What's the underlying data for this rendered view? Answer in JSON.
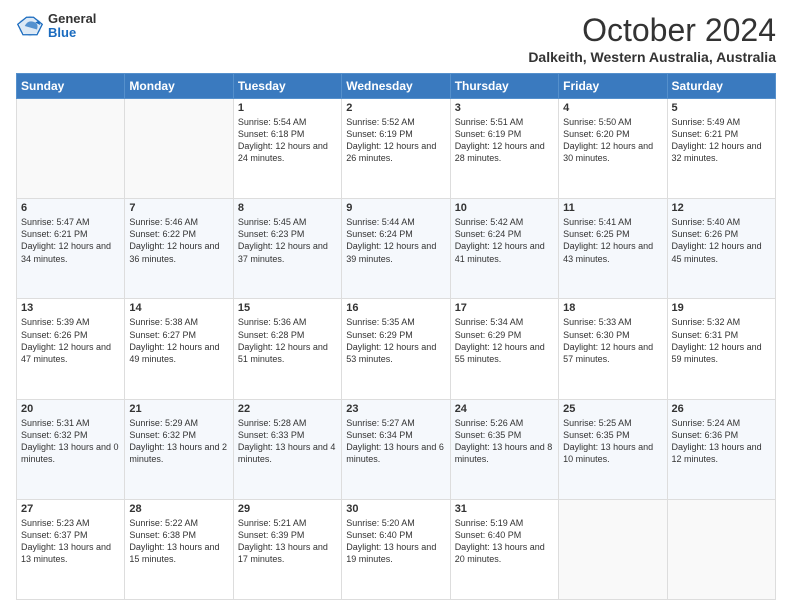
{
  "header": {
    "logo_general": "General",
    "logo_blue": "Blue",
    "month_title": "October 2024",
    "location": "Dalkeith, Western Australia, Australia"
  },
  "days_of_week": [
    "Sunday",
    "Monday",
    "Tuesday",
    "Wednesday",
    "Thursday",
    "Friday",
    "Saturday"
  ],
  "weeks": [
    [
      {
        "num": "",
        "info": ""
      },
      {
        "num": "",
        "info": ""
      },
      {
        "num": "1",
        "info": "Sunrise: 5:54 AM\nSunset: 6:18 PM\nDaylight: 12 hours and 24 minutes."
      },
      {
        "num": "2",
        "info": "Sunrise: 5:52 AM\nSunset: 6:19 PM\nDaylight: 12 hours and 26 minutes."
      },
      {
        "num": "3",
        "info": "Sunrise: 5:51 AM\nSunset: 6:19 PM\nDaylight: 12 hours and 28 minutes."
      },
      {
        "num": "4",
        "info": "Sunrise: 5:50 AM\nSunset: 6:20 PM\nDaylight: 12 hours and 30 minutes."
      },
      {
        "num": "5",
        "info": "Sunrise: 5:49 AM\nSunset: 6:21 PM\nDaylight: 12 hours and 32 minutes."
      }
    ],
    [
      {
        "num": "6",
        "info": "Sunrise: 5:47 AM\nSunset: 6:21 PM\nDaylight: 12 hours and 34 minutes."
      },
      {
        "num": "7",
        "info": "Sunrise: 5:46 AM\nSunset: 6:22 PM\nDaylight: 12 hours and 36 minutes."
      },
      {
        "num": "8",
        "info": "Sunrise: 5:45 AM\nSunset: 6:23 PM\nDaylight: 12 hours and 37 minutes."
      },
      {
        "num": "9",
        "info": "Sunrise: 5:44 AM\nSunset: 6:24 PM\nDaylight: 12 hours and 39 minutes."
      },
      {
        "num": "10",
        "info": "Sunrise: 5:42 AM\nSunset: 6:24 PM\nDaylight: 12 hours and 41 minutes."
      },
      {
        "num": "11",
        "info": "Sunrise: 5:41 AM\nSunset: 6:25 PM\nDaylight: 12 hours and 43 minutes."
      },
      {
        "num": "12",
        "info": "Sunrise: 5:40 AM\nSunset: 6:26 PM\nDaylight: 12 hours and 45 minutes."
      }
    ],
    [
      {
        "num": "13",
        "info": "Sunrise: 5:39 AM\nSunset: 6:26 PM\nDaylight: 12 hours and 47 minutes."
      },
      {
        "num": "14",
        "info": "Sunrise: 5:38 AM\nSunset: 6:27 PM\nDaylight: 12 hours and 49 minutes."
      },
      {
        "num": "15",
        "info": "Sunrise: 5:36 AM\nSunset: 6:28 PM\nDaylight: 12 hours and 51 minutes."
      },
      {
        "num": "16",
        "info": "Sunrise: 5:35 AM\nSunset: 6:29 PM\nDaylight: 12 hours and 53 minutes."
      },
      {
        "num": "17",
        "info": "Sunrise: 5:34 AM\nSunset: 6:29 PM\nDaylight: 12 hours and 55 minutes."
      },
      {
        "num": "18",
        "info": "Sunrise: 5:33 AM\nSunset: 6:30 PM\nDaylight: 12 hours and 57 minutes."
      },
      {
        "num": "19",
        "info": "Sunrise: 5:32 AM\nSunset: 6:31 PM\nDaylight: 12 hours and 59 minutes."
      }
    ],
    [
      {
        "num": "20",
        "info": "Sunrise: 5:31 AM\nSunset: 6:32 PM\nDaylight: 13 hours and 0 minutes."
      },
      {
        "num": "21",
        "info": "Sunrise: 5:29 AM\nSunset: 6:32 PM\nDaylight: 13 hours and 2 minutes."
      },
      {
        "num": "22",
        "info": "Sunrise: 5:28 AM\nSunset: 6:33 PM\nDaylight: 13 hours and 4 minutes."
      },
      {
        "num": "23",
        "info": "Sunrise: 5:27 AM\nSunset: 6:34 PM\nDaylight: 13 hours and 6 minutes."
      },
      {
        "num": "24",
        "info": "Sunrise: 5:26 AM\nSunset: 6:35 PM\nDaylight: 13 hours and 8 minutes."
      },
      {
        "num": "25",
        "info": "Sunrise: 5:25 AM\nSunset: 6:35 PM\nDaylight: 13 hours and 10 minutes."
      },
      {
        "num": "26",
        "info": "Sunrise: 5:24 AM\nSunset: 6:36 PM\nDaylight: 13 hours and 12 minutes."
      }
    ],
    [
      {
        "num": "27",
        "info": "Sunrise: 5:23 AM\nSunset: 6:37 PM\nDaylight: 13 hours and 13 minutes."
      },
      {
        "num": "28",
        "info": "Sunrise: 5:22 AM\nSunset: 6:38 PM\nDaylight: 13 hours and 15 minutes."
      },
      {
        "num": "29",
        "info": "Sunrise: 5:21 AM\nSunset: 6:39 PM\nDaylight: 13 hours and 17 minutes."
      },
      {
        "num": "30",
        "info": "Sunrise: 5:20 AM\nSunset: 6:40 PM\nDaylight: 13 hours and 19 minutes."
      },
      {
        "num": "31",
        "info": "Sunrise: 5:19 AM\nSunset: 6:40 PM\nDaylight: 13 hours and 20 minutes."
      },
      {
        "num": "",
        "info": ""
      },
      {
        "num": "",
        "info": ""
      }
    ]
  ]
}
